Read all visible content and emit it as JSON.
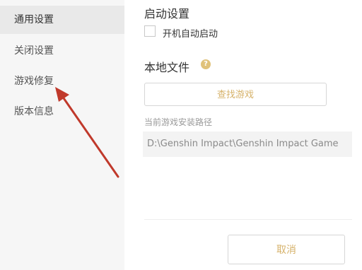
{
  "sidebar": {
    "items": [
      {
        "label": "通用设置",
        "active": true
      },
      {
        "label": "关闭设置",
        "active": false
      },
      {
        "label": "游戏修复",
        "active": false
      },
      {
        "label": "版本信息",
        "active": false
      }
    ]
  },
  "startup": {
    "title": "启动设置",
    "autostart_label": "开机自动启动",
    "autostart_checked": false
  },
  "local_files": {
    "title": "本地文件",
    "help_icon": "question-circle-icon",
    "find_game_label": "查找游戏",
    "install_path_label": "当前游戏安装路径",
    "install_path_value": "D:\\Genshin Impact\\Genshin Impact Game"
  },
  "footer": {
    "cancel_label": "取消"
  },
  "colors": {
    "accent": "#d6b26a",
    "arrow": "#c0392b",
    "sidebar_bg": "#f6f6f6",
    "sidebar_active_bg": "#e9e9e9"
  }
}
